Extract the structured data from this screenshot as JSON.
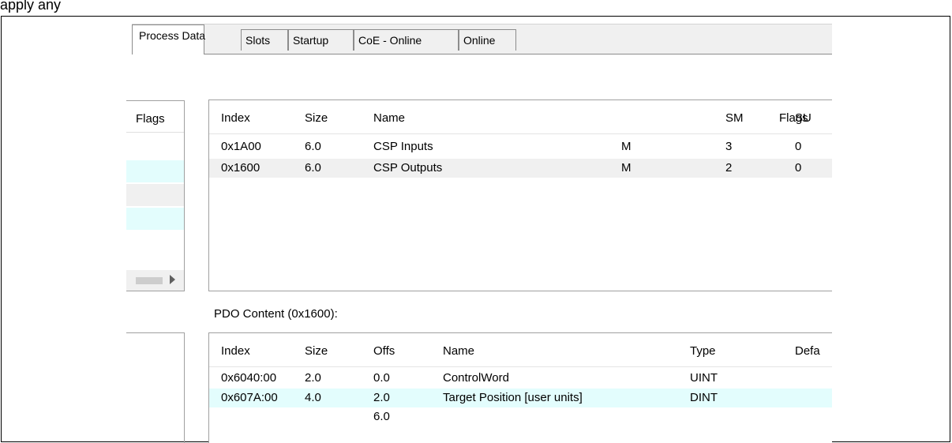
{
  "header_text": "apply any",
  "tabs": [
    {
      "label": "Process Data",
      "active": true
    },
    {
      "label": "Slots",
      "active": false
    },
    {
      "label": "Startup",
      "active": false
    },
    {
      "label": "CoE - Online",
      "active": false
    },
    {
      "label": "Online",
      "active": false
    }
  ],
  "left_list": {
    "header": "Flags"
  },
  "pdo_list": {
    "columns": [
      "Index",
      "Size",
      "Name",
      "Flags",
      "SM",
      "SU"
    ],
    "rows": [
      [
        "0x1A00",
        "6.0",
        "CSP Inputs",
        "M",
        "3",
        "0"
      ],
      [
        "0x1600",
        "6.0",
        "CSP Outputs",
        "M",
        "2",
        "0"
      ]
    ]
  },
  "pdo_content": {
    "label": "PDO Content (0x1600):",
    "columns": [
      "Index",
      "Size",
      "Offs",
      "Name",
      "Type",
      "Defa"
    ],
    "rows": [
      [
        "0x6040:00",
        "2.0",
        "0.0",
        "ControlWord",
        "UINT",
        ""
      ],
      [
        "0x607A:00",
        "4.0",
        "2.0",
        "Target Position [user units]",
        "DINT",
        ""
      ],
      [
        "",
        "",
        "6.0",
        "",
        "",
        ""
      ]
    ]
  },
  "colors": {
    "selected_row": "#e3fdfd",
    "alt_row": "#f0f0f0",
    "tab_bg": "#f0f0f0"
  }
}
